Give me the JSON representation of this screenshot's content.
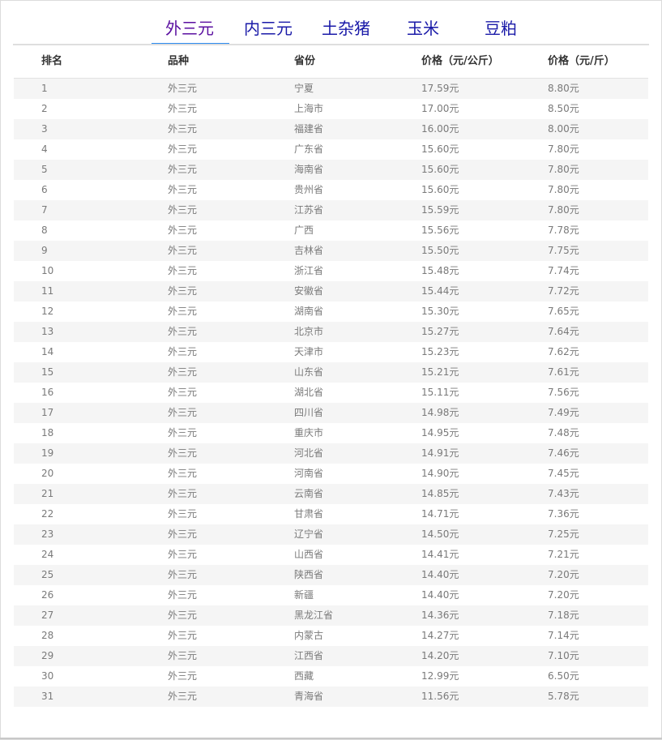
{
  "tabs": [
    {
      "label": "外三元",
      "active": true
    },
    {
      "label": "内三元",
      "active": false
    },
    {
      "label": "土杂猪",
      "active": false
    },
    {
      "label": "玉米",
      "active": false
    },
    {
      "label": "豆粕",
      "active": false
    }
  ],
  "table": {
    "headers": [
      "排名",
      "品种",
      "省份",
      "价格（元/公斤）",
      "价格（元/斤）"
    ],
    "rows": [
      [
        "1",
        "外三元",
        "宁夏",
        "17.59元",
        "8.80元"
      ],
      [
        "2",
        "外三元",
        "上海市",
        "17.00元",
        "8.50元"
      ],
      [
        "3",
        "外三元",
        "福建省",
        "16.00元",
        "8.00元"
      ],
      [
        "4",
        "外三元",
        "广东省",
        "15.60元",
        "7.80元"
      ],
      [
        "5",
        "外三元",
        "海南省",
        "15.60元",
        "7.80元"
      ],
      [
        "6",
        "外三元",
        "贵州省",
        "15.60元",
        "7.80元"
      ],
      [
        "7",
        "外三元",
        "江苏省",
        "15.59元",
        "7.80元"
      ],
      [
        "8",
        "外三元",
        "广西",
        "15.56元",
        "7.78元"
      ],
      [
        "9",
        "外三元",
        "吉林省",
        "15.50元",
        "7.75元"
      ],
      [
        "10",
        "外三元",
        "浙江省",
        "15.48元",
        "7.74元"
      ],
      [
        "11",
        "外三元",
        "安徽省",
        "15.44元",
        "7.72元"
      ],
      [
        "12",
        "外三元",
        "湖南省",
        "15.30元",
        "7.65元"
      ],
      [
        "13",
        "外三元",
        "北京市",
        "15.27元",
        "7.64元"
      ],
      [
        "14",
        "外三元",
        "天津市",
        "15.23元",
        "7.62元"
      ],
      [
        "15",
        "外三元",
        "山东省",
        "15.21元",
        "7.61元"
      ],
      [
        "16",
        "外三元",
        "湖北省",
        "15.11元",
        "7.56元"
      ],
      [
        "17",
        "外三元",
        "四川省",
        "14.98元",
        "7.49元"
      ],
      [
        "18",
        "外三元",
        "重庆市",
        "14.95元",
        "7.48元"
      ],
      [
        "19",
        "外三元",
        "河北省",
        "14.91元",
        "7.46元"
      ],
      [
        "20",
        "外三元",
        "河南省",
        "14.90元",
        "7.45元"
      ],
      [
        "21",
        "外三元",
        "云南省",
        "14.85元",
        "7.43元"
      ],
      [
        "22",
        "外三元",
        "甘肃省",
        "14.71元",
        "7.36元"
      ],
      [
        "23",
        "外三元",
        "辽宁省",
        "14.50元",
        "7.25元"
      ],
      [
        "24",
        "外三元",
        "山西省",
        "14.41元",
        "7.21元"
      ],
      [
        "25",
        "外三元",
        "陕西省",
        "14.40元",
        "7.20元"
      ],
      [
        "26",
        "外三元",
        "新疆",
        "14.40元",
        "7.20元"
      ],
      [
        "27",
        "外三元",
        "黑龙江省",
        "14.36元",
        "7.18元"
      ],
      [
        "28",
        "外三元",
        "内蒙古",
        "14.27元",
        "7.14元"
      ],
      [
        "29",
        "外三元",
        "江西省",
        "14.20元",
        "7.10元"
      ],
      [
        "30",
        "外三元",
        "西藏",
        "12.99元",
        "6.50元"
      ],
      [
        "31",
        "外三元",
        "青海省",
        "11.56元",
        "5.78元"
      ]
    ]
  }
}
